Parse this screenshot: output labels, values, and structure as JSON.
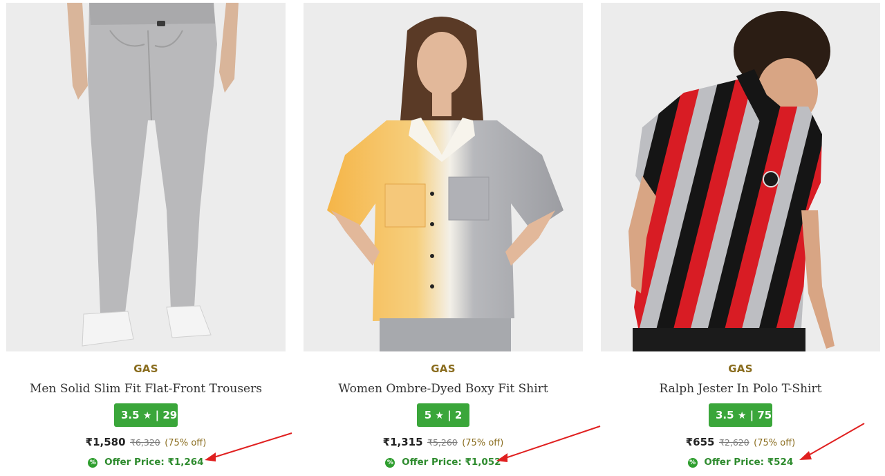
{
  "products": [
    {
      "brand": "GAS",
      "name": "Men Solid Slim Fit Flat-Front Trousers",
      "rating": "3.5",
      "reviews": "29",
      "price": "₹1,580",
      "mrp": "₹6,320",
      "discount": "(75% off)",
      "offer_label": "Offer Price:",
      "offer_price": "₹1,264",
      "image_alt": "grey slim fit trousers"
    },
    {
      "brand": "GAS",
      "name": "Women Ombre-Dyed Boxy Fit Shirt",
      "rating": "5",
      "reviews": "2",
      "price": "₹1,315",
      "mrp": "₹5,260",
      "discount": "(75% off)",
      "offer_label": "Offer Price:",
      "offer_price": "₹1,052",
      "image_alt": "yellow and grey ombre shirt"
    },
    {
      "brand": "GAS",
      "name": "Ralph Jester In Polo T-Shirt",
      "rating": "3.5",
      "reviews": "75",
      "price": "₹655",
      "mrp": "₹2,620",
      "discount": "(75% off)",
      "offer_label": "Offer Price:",
      "offer_price": "₹524",
      "image_alt": "red black grey striped polo t-shirt"
    }
  ],
  "rating_separator": "|",
  "star_icon": "★",
  "offer_icon": "%",
  "colors": {
    "brand_text": "#8a6d1f",
    "rating_badge": "#3aa63a",
    "offer_text": "#2e8b2e",
    "annotation_arrow": "#e02020"
  }
}
